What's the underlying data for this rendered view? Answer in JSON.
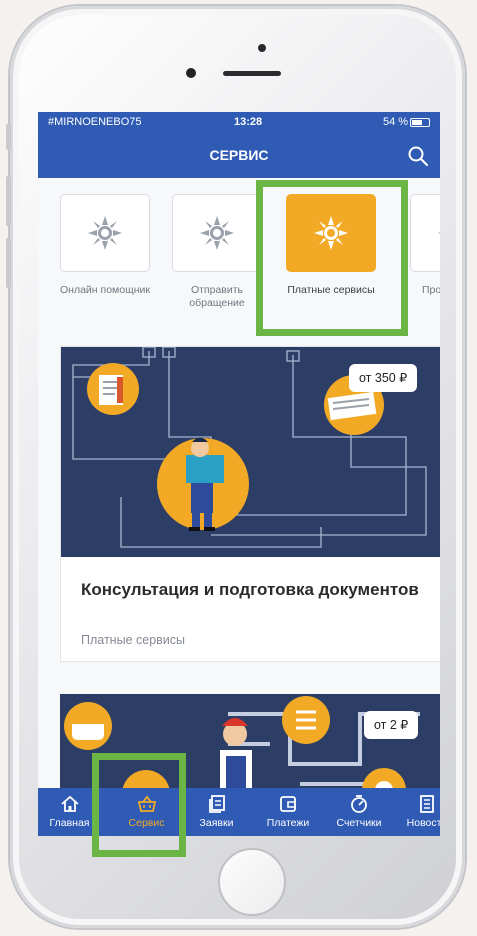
{
  "status_bar": {
    "carrier": "#MIRNOENEBO75",
    "time": "13:28",
    "battery": "54 %"
  },
  "app_bar": {
    "title": "СЕРВИС"
  },
  "categories": [
    {
      "label": "Онлайн помощник"
    },
    {
      "label": "Отправить обращение"
    },
    {
      "label": "Платные сервисы",
      "selected": true
    },
    {
      "label": "Прочие сервисы"
    }
  ],
  "cards": [
    {
      "price": "от 350 ₽",
      "title": "Консультация и подготовка документов",
      "subtitle": "Платные сервисы"
    },
    {
      "price": "от 2 ₽"
    }
  ],
  "tabs": [
    {
      "label": "Главная",
      "icon": "home-icon"
    },
    {
      "label": "Сервис",
      "icon": "basket-icon",
      "active": true
    },
    {
      "label": "Заявки",
      "icon": "requests-icon"
    },
    {
      "label": "Платежи",
      "icon": "wallet-icon"
    },
    {
      "label": "Счетчики",
      "icon": "meter-icon"
    },
    {
      "label": "Новости",
      "icon": "news-icon"
    }
  ],
  "colors": {
    "primary": "#2f5bb5",
    "accent": "#f2aa26",
    "highlight": "#6bb544",
    "card_bg": "#2c3e66"
  }
}
